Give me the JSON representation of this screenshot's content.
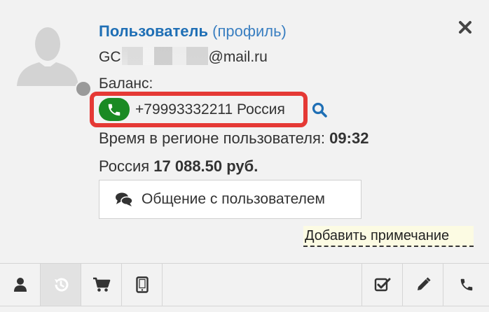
{
  "user": {
    "name": "Пользователь",
    "profile_link": "(профиль)",
    "email_prefix": "GC",
    "email_domain": "@mail.ru",
    "balance_label": "Баланс:",
    "phone": "+79993332211 Россия",
    "time_label": "Время в регионе пользователя: ",
    "time_value": "09:32",
    "money_prefix": "Россия ",
    "money_value": "17 088.50 руб."
  },
  "actions": {
    "chat_label": "Общение с пользователем",
    "add_note_label": "Добавить примечание"
  },
  "toolbar": {
    "left": [
      "user-icon",
      "history-icon",
      "cart-icon",
      "tablet-icon"
    ],
    "right": [
      "checkbox-icon",
      "pencil-icon",
      "phone-icon"
    ],
    "active": "history-icon"
  },
  "colors": {
    "link": "#1f6fb5",
    "highlight_border": "#e53935",
    "phone_badge": "#1a8a23",
    "note_background": "#fcfbe3"
  }
}
